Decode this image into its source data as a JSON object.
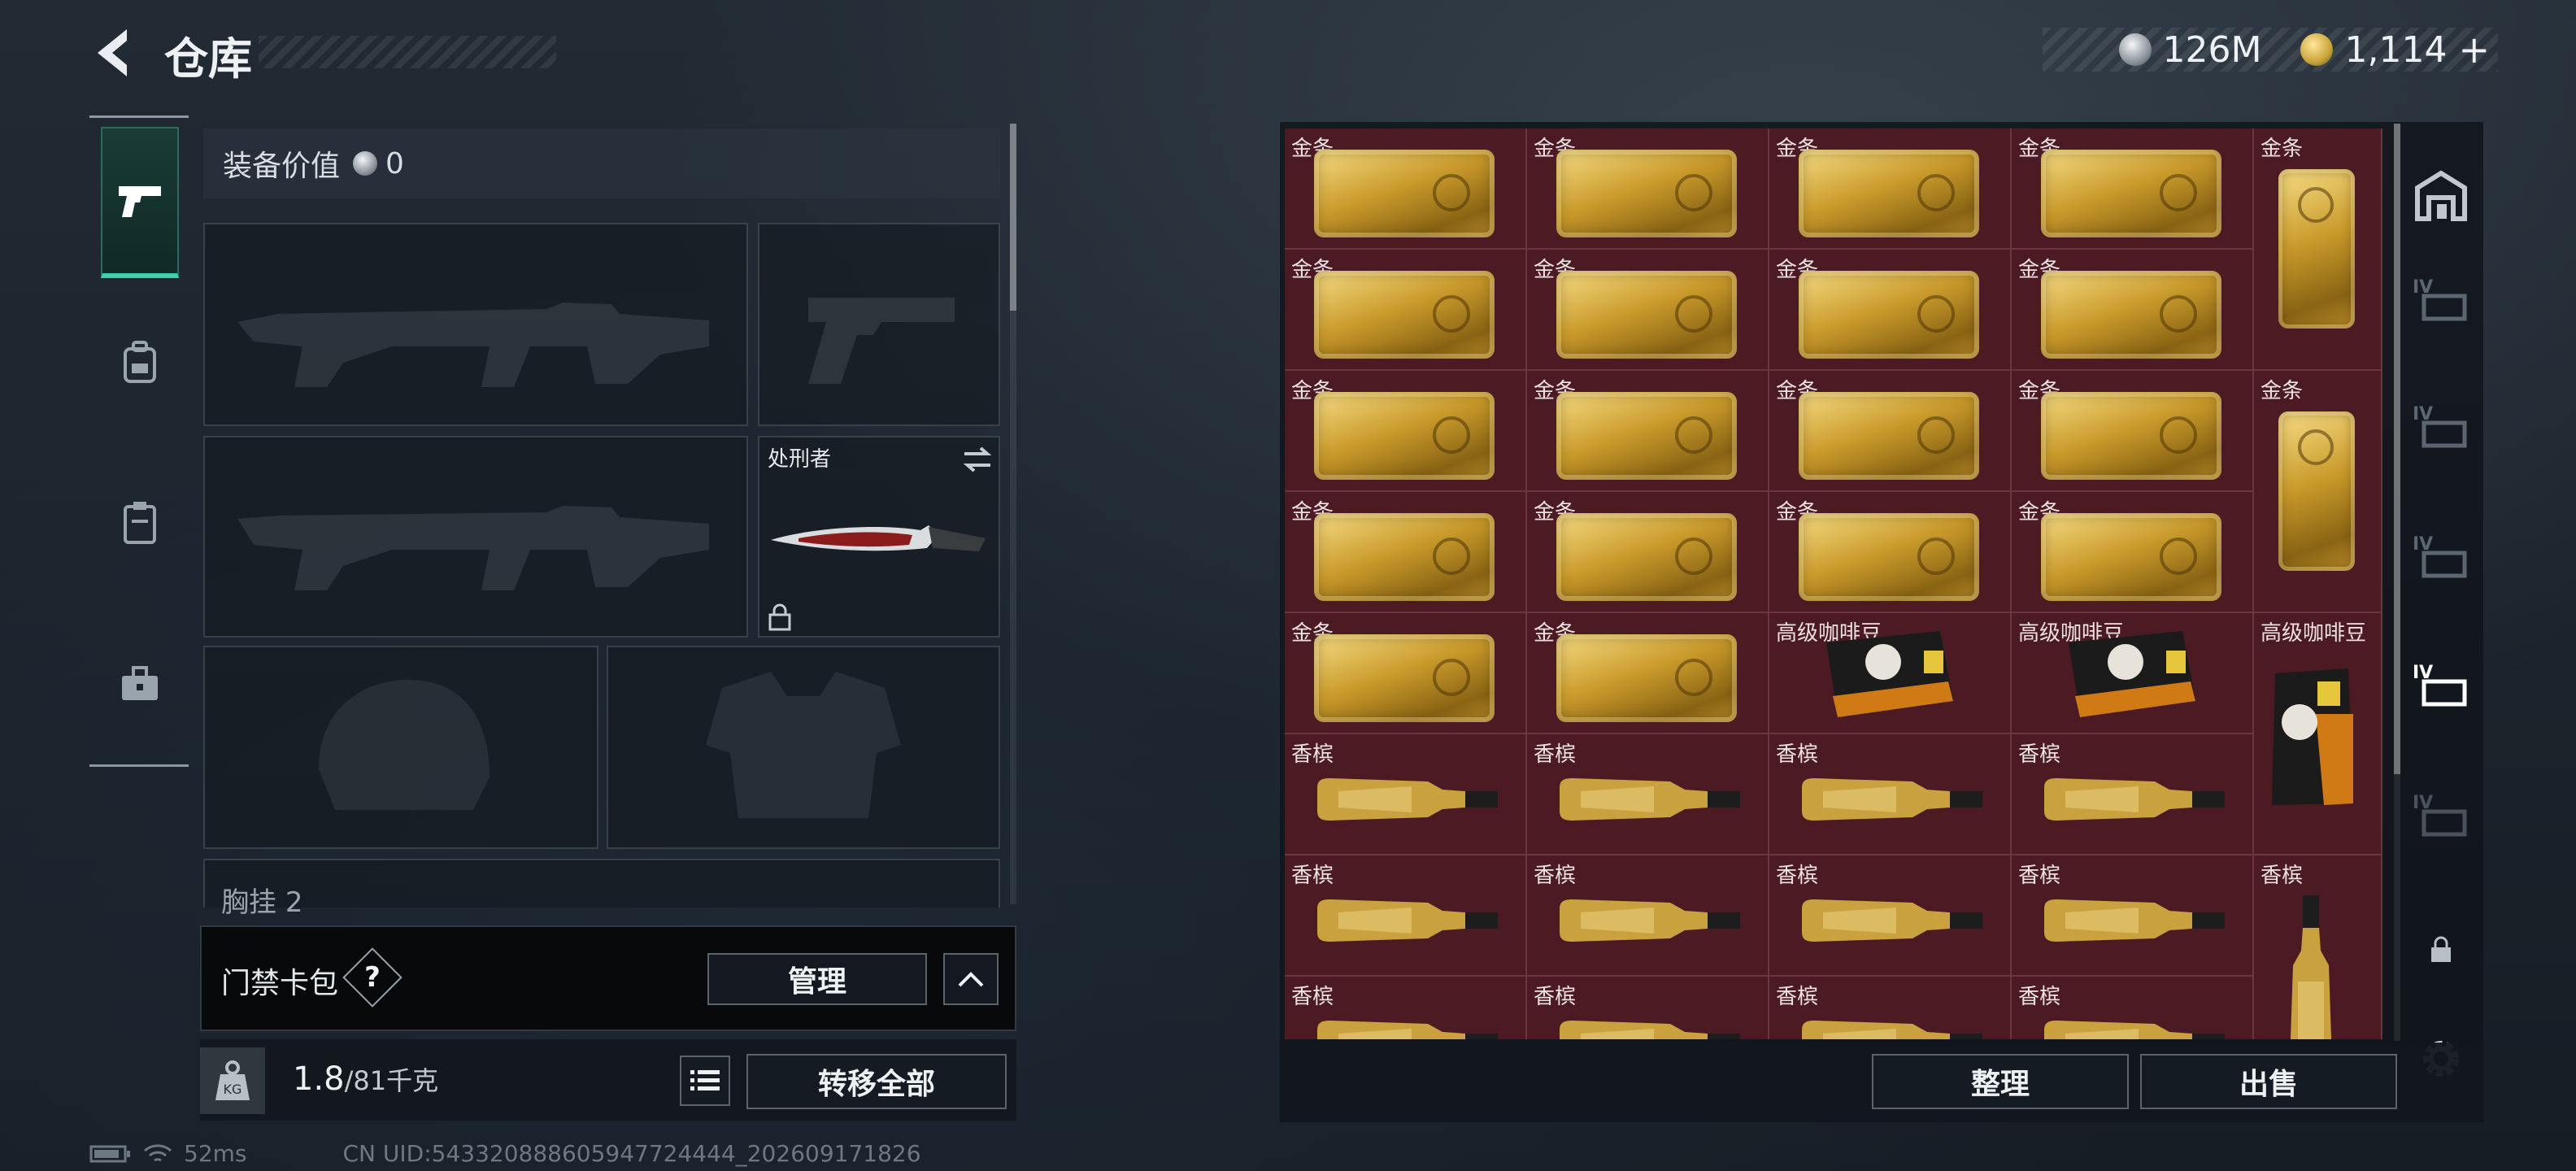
{
  "header": {
    "title": "仓库"
  },
  "currency": {
    "silver": "126M",
    "gold": "1,114",
    "add": "+"
  },
  "equipment": {
    "value_label": "装备价值",
    "value": "0",
    "melee_name": "处刑者",
    "chest_label": "胸挂",
    "chest_count": "2"
  },
  "card_pack": {
    "label": "门禁卡包",
    "help": "?",
    "manage": "管理"
  },
  "weight": {
    "current": "1.8",
    "max": "/81千克",
    "transfer_all": "转移全部"
  },
  "status": {
    "ping": "52ms",
    "uid": "CN UID:543320888605947724444_202609171826"
  },
  "inventory": {
    "columns": 5,
    "items": [
      {
        "label": "金条",
        "type": "gold-h"
      },
      {
        "label": "金条",
        "type": "gold-h"
      },
      {
        "label": "金条",
        "type": "gold-h"
      },
      {
        "label": "金条",
        "type": "gold-h"
      },
      {
        "label": "金条",
        "type": "gold-v"
      },
      {
        "label": "金条",
        "type": "gold-h"
      },
      {
        "label": "金条",
        "type": "gold-h"
      },
      {
        "label": "金条",
        "type": "gold-h"
      },
      {
        "label": "金条",
        "type": "gold-h"
      },
      {
        "label": "金条",
        "type": "gold-h"
      },
      {
        "label": "金条",
        "type": "gold-h"
      },
      {
        "label": "金条",
        "type": "gold-h"
      },
      {
        "label": "金条",
        "type": "gold-h"
      },
      {
        "label": "金条",
        "type": "gold-v"
      },
      {
        "label": "金条",
        "type": "gold-h"
      },
      {
        "label": "金条",
        "type": "gold-h"
      },
      {
        "label": "金条",
        "type": "gold-h"
      },
      {
        "label": "金条",
        "type": "gold-h"
      },
      {
        "label": "金条",
        "type": "gold-h"
      },
      {
        "label": "金条",
        "type": "gold-h"
      },
      {
        "label": "高级咖啡豆",
        "type": "coffee"
      },
      {
        "label": "高级咖啡豆",
        "type": "coffee"
      },
      {
        "label": "高级咖啡豆",
        "type": "coffee-v"
      },
      {
        "label": "香槟",
        "type": "bottle"
      },
      {
        "label": "香槟",
        "type": "bottle"
      },
      {
        "label": "香槟",
        "type": "bottle"
      },
      {
        "label": "香槟",
        "type": "bottle"
      },
      {
        "label": "香槟",
        "type": "bottle"
      },
      {
        "label": "香槟",
        "type": "bottle"
      },
      {
        "label": "香槟",
        "type": "bottle"
      },
      {
        "label": "香槟",
        "type": "bottle"
      },
      {
        "label": "香槟",
        "type": "bottle-v"
      },
      {
        "label": "香槟",
        "type": "bottle"
      },
      {
        "label": "香槟",
        "type": "bottle"
      },
      {
        "label": "香槟",
        "type": "bottle"
      },
      {
        "label": "香槟",
        "type": "bottle"
      }
    ]
  },
  "actions": {
    "sort": "整理",
    "sell": "出售"
  },
  "colors": {
    "accent": "#3ed0a8",
    "grid_bg": "#4b1a22",
    "gold": "#c99a2b"
  },
  "icons": [
    "back-arrow-icon",
    "pistol-icon",
    "backpack-icon",
    "clipboard-icon",
    "toolbox-icon",
    "lock-icon",
    "swap-icon",
    "list-icon",
    "weight-icon",
    "warehouse-icon",
    "storage-iv-icon",
    "gear-icon",
    "battery-icon",
    "wifi-icon"
  ]
}
